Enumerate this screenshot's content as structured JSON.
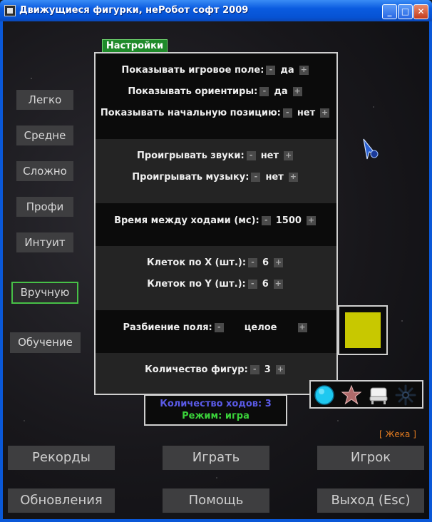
{
  "window": {
    "title": "Движущиеся фигурки, неРобот софт 2009",
    "controls": {
      "minimize": "_",
      "maximize": "□",
      "close": "✕"
    }
  },
  "difficulty": [
    "Легко",
    "Средне",
    "Сложно",
    "Профи",
    "Интуит",
    "Вручную"
  ],
  "difficulty_selected": "Вручную",
  "tutorial_button": "Обучение",
  "settings": {
    "tab_label": "Настройки",
    "minus": "-",
    "plus": "+",
    "show_field": {
      "label": "Показывать игровое поле:",
      "value": "да"
    },
    "show_guides": {
      "label": "Показывать ориентиры:",
      "value": "да"
    },
    "show_start": {
      "label": "Показывать начальную позицию:",
      "value": "нет"
    },
    "play_sounds": {
      "label": "Проигрывать звуки:",
      "value": "нет"
    },
    "play_music": {
      "label": "Проигрывать музыку:",
      "value": "нет"
    },
    "move_time": {
      "label": "Время между ходами (мс):",
      "value": "1500"
    },
    "cells_x": {
      "label": "Клеток по X (шт.):",
      "value": "6"
    },
    "cells_y": {
      "label": "Клеток по Y (шт.):",
      "value": "6"
    },
    "field_split": {
      "label": "Разбиение поля:",
      "value": "целое"
    },
    "figure_count": {
      "label": "Количество фигур:",
      "value": "3"
    }
  },
  "colors": {
    "swatch": "#c8c800",
    "accent_green": "#3ad23a",
    "moves_blue": "#5a5ae6",
    "user_orange": "#e07a20"
  },
  "figures": [
    "circle-icon",
    "star-icon",
    "chair-icon",
    "snowflake-icon"
  ],
  "info": {
    "moves": "Количество ходов: 3",
    "mode": "Режим: игра"
  },
  "user_tag": "[ Жека ]",
  "buttons": {
    "records": "Рекорды",
    "play": "Играть",
    "player": "Игрок",
    "updates": "Обновления",
    "help": "Помощь",
    "exit": "Выход (Esc)"
  }
}
